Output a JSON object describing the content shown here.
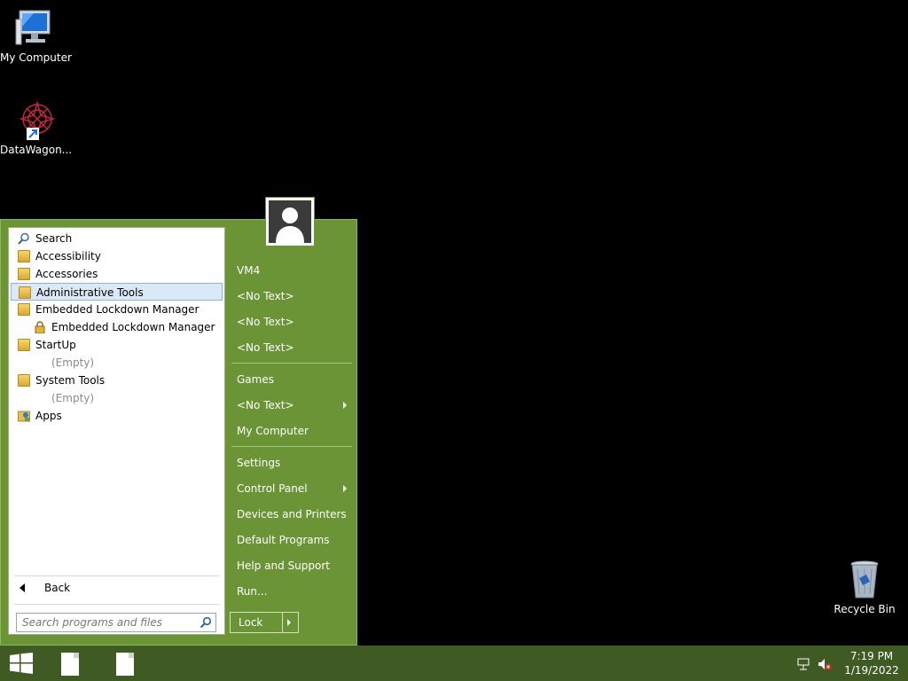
{
  "desktop": {
    "icons": [
      {
        "label": "My Computer",
        "icon": "monitor-computer-icon"
      },
      {
        "label": "DataWagon...",
        "icon": "datawagon-shortcut-icon"
      },
      {
        "label": "Recycle Bin",
        "icon": "recycle-bin-icon"
      }
    ]
  },
  "start_menu": {
    "programs": [
      {
        "label": "Search",
        "icon": "search-icon"
      },
      {
        "label": "Accessibility",
        "icon": "folder-icon"
      },
      {
        "label": "Accessories",
        "icon": "folder-icon"
      },
      {
        "label": "Administrative Tools",
        "icon": "folder-icon",
        "selected": true
      },
      {
        "label": "Embedded Lockdown Manager",
        "icon": "folder-icon"
      },
      {
        "label": "Embedded Lockdown Manager",
        "icon": "lock-icon"
      },
      {
        "label": "StartUp",
        "icon": "folder-icon"
      },
      {
        "label": "(Empty)"
      },
      {
        "label": "System Tools",
        "icon": "folder-icon"
      },
      {
        "label": "(Empty)"
      },
      {
        "label": "Apps",
        "icon": "apps-folder-icon"
      }
    ],
    "back_label": "Back",
    "search_placeholder": "Search programs and files",
    "right_items": [
      {
        "label": "VM4"
      },
      {
        "label": "<No Text>"
      },
      {
        "label": "<No Text>"
      },
      {
        "label": "<No Text>"
      },
      {
        "label": "Games"
      },
      {
        "label": "<No Text>",
        "submenu": true
      },
      {
        "label": "My Computer"
      },
      {
        "label": "Settings"
      },
      {
        "label": "Control Panel",
        "submenu": true
      },
      {
        "label": "Devices and Printers"
      },
      {
        "label": "Default Programs"
      },
      {
        "label": "Help and Support"
      },
      {
        "label": "Run..."
      }
    ],
    "lock_label": "Lock"
  },
  "taskbar": {
    "time": "7:19 PM",
    "date": "1/19/2022",
    "tray_icons": [
      "network-icon",
      "volume-muted-icon"
    ]
  },
  "colors": {
    "menu_green": "#6b9436",
    "taskbar_green": "#3f5a23",
    "selection": "#dbe8f7"
  }
}
